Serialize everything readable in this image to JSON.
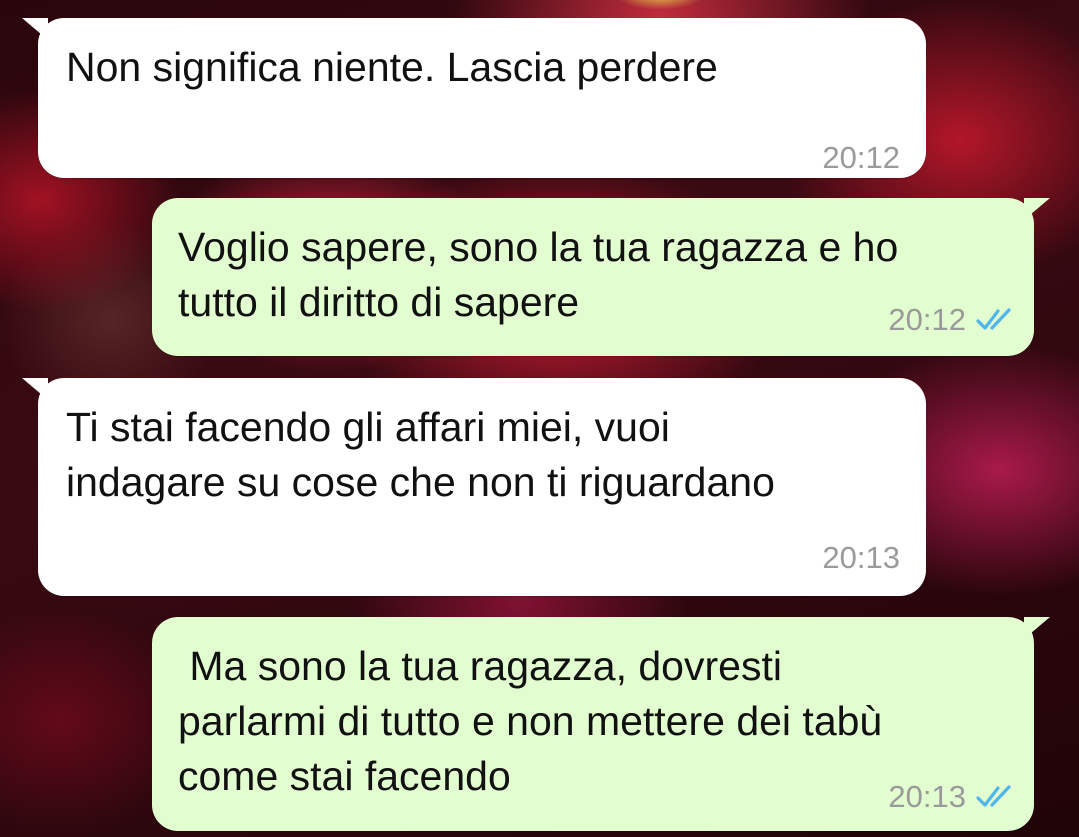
{
  "chat": {
    "messages": [
      {
        "direction": "incoming",
        "text": "Non significa niente. Lascia perdere",
        "time": "20:12",
        "status_icon": null
      },
      {
        "direction": "outgoing",
        "text": "Voglio sapere, sono la tua ragazza e ho\ntutto il diritto di sapere",
        "time": "20:12",
        "status_icon": "double-check-read-icon"
      },
      {
        "direction": "incoming",
        "text": "Ti stai facendo gli affari miei, vuoi\nindagare su cose che non ti riguardano",
        "time": "20:13",
        "status_icon": null
      },
      {
        "direction": "outgoing",
        "text": " Ma sono la tua ragazza, dovresti\nparlarmi di tutto e non mettere dei tabù\ncome stai facendo",
        "time": "20:13",
        "status_icon": "double-check-read-icon"
      }
    ]
  },
  "colors": {
    "incoming_bubble": "#ffffff",
    "outgoing_bubble": "#e2fdd0",
    "timestamp": "#9a9a9a",
    "read_check": "#4fb6ec",
    "wallpaper_accent": "#d41e3c"
  },
  "wallpaper": {
    "icon": "red-flowers-wallpaper"
  }
}
